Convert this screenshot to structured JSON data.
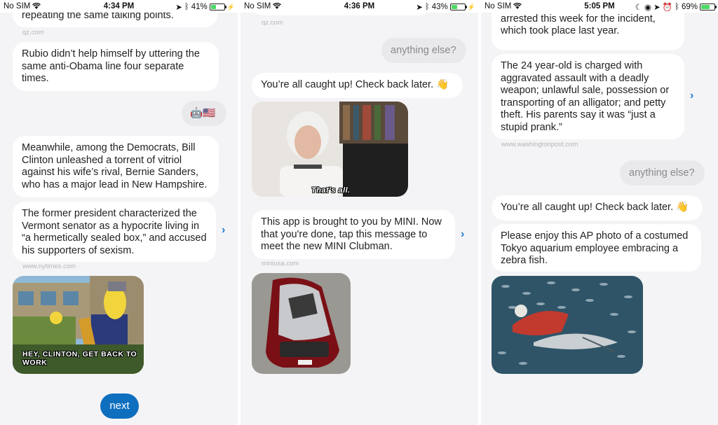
{
  "screens": [
    {
      "status": {
        "carrier": "No SIM",
        "time": "4:34 PM",
        "battery": "41%",
        "battery_level": 0.41
      },
      "messages": {
        "top_cut": "repeating the same talking points.",
        "top_src": "qz.com",
        "b1": "Rubio didn’t help himself by uttering the same anti-Obama line four separate times.",
        "user_emoji": "🤖🇺🇸",
        "b2": "Meanwhile, among the Democrats, Bill Clinton unleashed a torrent of vitriol against his wife’s rival, Bernie Sanders, who has a major lead in New Hampshire.",
        "b3": "The former president characterized the Vermont senator as a hypocrite living in “a hermetically sealed box,” and accused his supporters of sexism.",
        "b3_src": "www.nytimes.com",
        "img_caption": "HEY, CLINTON, GET BACK TO WORK",
        "next_label": "next"
      }
    },
    {
      "status": {
        "carrier": "No SIM",
        "time": "4:36 PM",
        "battery": "43%",
        "battery_level": 0.43
      },
      "messages": {
        "top_src": "qz.com",
        "user": "anything else?",
        "b1": "You’re all caught up! Check back later. 👋",
        "img_caption": "That's all.",
        "b2": "This app is brought to you by MINI. Now that you're done, tap this message to meet the new MINI Clubman.",
        "b2_src": "miniusa.com"
      }
    },
    {
      "status": {
        "carrier": "No SIM",
        "time": "5:05 PM",
        "battery": "69%",
        "battery_level": 0.69
      },
      "messages": {
        "top_cut": "driver’s seat of his car. He was arrested this week for the incident, which took place last year.",
        "b1": "The 24 year-old is charged with aggravated assault with a deadly weapon; unlawful sale, possession or transporting of an alligator; and petty theft. His parents say it was “just a stupid prank.”",
        "b1_src": "www.washingtonpost.com",
        "user": "anything else?",
        "b2": "You’re all caught up! Check back later. 👋",
        "b3": "Please enjoy this AP photo of a costumed Tokyo aquarium employee embracing a zebra fish."
      }
    }
  ]
}
